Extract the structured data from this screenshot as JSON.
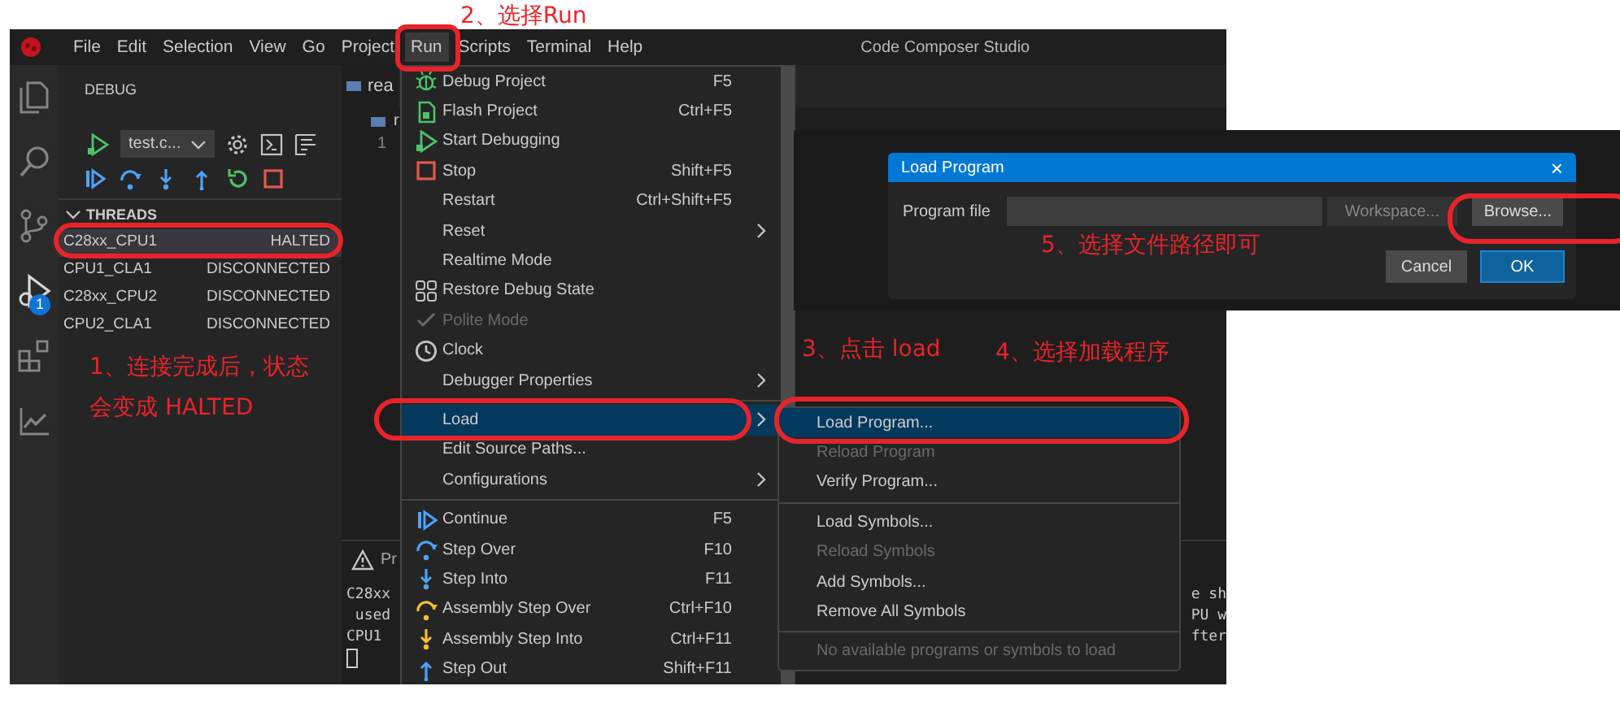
{
  "title_bar": {
    "menus": [
      {
        "label": "File",
        "selected": false
      },
      {
        "label": "Edit",
        "selected": false
      },
      {
        "label": "Selection",
        "selected": false
      },
      {
        "label": "View",
        "selected": false
      },
      {
        "label": "Go",
        "selected": false
      },
      {
        "label": "Project",
        "selected": false
      },
      {
        "label": "Run",
        "selected": true
      },
      {
        "label": "Scripts",
        "selected": false
      },
      {
        "label": "Terminal",
        "selected": false
      },
      {
        "label": "Help",
        "selected": false
      }
    ],
    "title": "Code Composer Studio"
  },
  "activity_bar": {
    "badge": "1"
  },
  "debug_panel": {
    "title": "DEBUG",
    "config": "test.c...",
    "threads_header": "THREADS",
    "threads": [
      {
        "name": "C28xx_CPU1",
        "state": "HALTED",
        "selected": true
      },
      {
        "name": "CPU1_CLA1",
        "state": "DISCONNECTED",
        "selected": false
      },
      {
        "name": "C28xx_CPU2",
        "state": "DISCONNECTED",
        "selected": false
      },
      {
        "name": "CPU2_CLA1",
        "state": "DISCONNECTED",
        "selected": false
      }
    ]
  },
  "editor": {
    "tab": "rea",
    "breadcrumb": "r",
    "line_number": "1"
  },
  "panel": {
    "tab": "Pr",
    "lines": [
      "C28xx",
      " used",
      "CPU1"
    ],
    "right_lines": [
      "e sh",
      "PU w",
      "fter"
    ]
  },
  "run_menu": {
    "items": [
      {
        "kind": "item",
        "label": "Debug Project",
        "shortcut": "F5",
        "disabled": false,
        "checked": false,
        "selected": false
      },
      {
        "kind": "item",
        "label": "Flash Project",
        "shortcut": "Ctrl+F5",
        "disabled": false,
        "checked": false,
        "selected": false
      },
      {
        "kind": "item",
        "label": "Start Debugging",
        "disabled": false,
        "checked": false,
        "selected": false
      },
      {
        "kind": "item",
        "label": "Stop",
        "shortcut": "Shift+F5",
        "disabled": false,
        "checked": false,
        "selected": false
      },
      {
        "kind": "item",
        "label": "Restart",
        "shortcut": "Ctrl+Shift+F5",
        "disabled": false,
        "checked": false,
        "selected": false
      },
      {
        "kind": "submenu",
        "label": "Reset",
        "disabled": false,
        "checked": false,
        "selected": false
      },
      {
        "kind": "item",
        "label": "Realtime Mode",
        "disabled": false,
        "checked": false,
        "selected": false
      },
      {
        "kind": "item",
        "label": "Restore Debug State",
        "disabled": false,
        "checked": false,
        "selected": false
      },
      {
        "kind": "item",
        "label": "Polite Mode",
        "disabled": true,
        "checked": true,
        "selected": false
      },
      {
        "kind": "item",
        "label": "Clock",
        "disabled": false,
        "checked": false,
        "selected": false
      },
      {
        "kind": "submenu",
        "label": "Debugger Properties",
        "disabled": false,
        "checked": false,
        "selected": false
      },
      {
        "kind": "separator"
      },
      {
        "kind": "submenu",
        "label": "Load",
        "disabled": false,
        "checked": false,
        "selected": true
      },
      {
        "kind": "item",
        "label": "Edit Source Paths...",
        "disabled": false,
        "checked": false,
        "selected": false
      },
      {
        "kind": "submenu",
        "label": "Configurations",
        "disabled": false,
        "checked": false,
        "selected": false
      },
      {
        "kind": "separator"
      },
      {
        "kind": "item",
        "label": "Continue",
        "shortcut": "F5",
        "disabled": false,
        "checked": false,
        "selected": false
      },
      {
        "kind": "item",
        "label": "Step Over",
        "shortcut": "F10",
        "disabled": false,
        "checked": false,
        "selected": false
      },
      {
        "kind": "item",
        "label": "Step Into",
        "shortcut": "F11",
        "disabled": false,
        "checked": false,
        "selected": false
      },
      {
        "kind": "item",
        "label": "Assembly Step Over",
        "shortcut": "Ctrl+F10",
        "disabled": false,
        "checked": false,
        "selected": false
      },
      {
        "kind": "item",
        "label": "Assembly Step Into",
        "shortcut": "Ctrl+F11",
        "disabled": false,
        "checked": false,
        "selected": false
      },
      {
        "kind": "item",
        "label": "Step Out",
        "shortcut": "Shift+F11",
        "disabled": false,
        "checked": false,
        "selected": false
      }
    ]
  },
  "load_submenu": {
    "items": [
      {
        "kind": "item",
        "label": "Load Program...",
        "disabled": false,
        "selected": true
      },
      {
        "kind": "item",
        "label": "Reload Program",
        "disabled": true,
        "selected": false
      },
      {
        "kind": "item",
        "label": "Verify Program...",
        "disabled": false,
        "selected": false
      },
      {
        "kind": "separator"
      },
      {
        "kind": "item",
        "label": "Load Symbols...",
        "disabled": false,
        "selected": false
      },
      {
        "kind": "item",
        "label": "Reload Symbols",
        "disabled": true,
        "selected": false
      },
      {
        "kind": "item",
        "label": "Add Symbols...",
        "disabled": false,
        "selected": false
      },
      {
        "kind": "item",
        "label": "Remove All Symbols",
        "disabled": false,
        "selected": false
      },
      {
        "kind": "separator"
      },
      {
        "kind": "item",
        "label": "No available programs or symbols to load",
        "disabled": true,
        "selected": false
      }
    ]
  },
  "load_dialog": {
    "title": "Load Program",
    "close": "×",
    "field_label": "Program file",
    "buttons": [
      {
        "kind": "workspace",
        "label": "Workspace..."
      },
      {
        "kind": "browse",
        "label": "Browse..."
      },
      {
        "kind": "cancel",
        "label": "Cancel"
      },
      {
        "kind": "ok",
        "label": "OK"
      }
    ]
  },
  "annotations": [
    {
      "text": "2、选择Run"
    },
    {
      "text": "5、选择文件路径即可"
    },
    {
      "text": "1、连接完成后，状态会变成 HALTED"
    },
    {
      "text": "3、点击 load"
    },
    {
      "text": "4、选择加载程序"
    }
  ]
}
